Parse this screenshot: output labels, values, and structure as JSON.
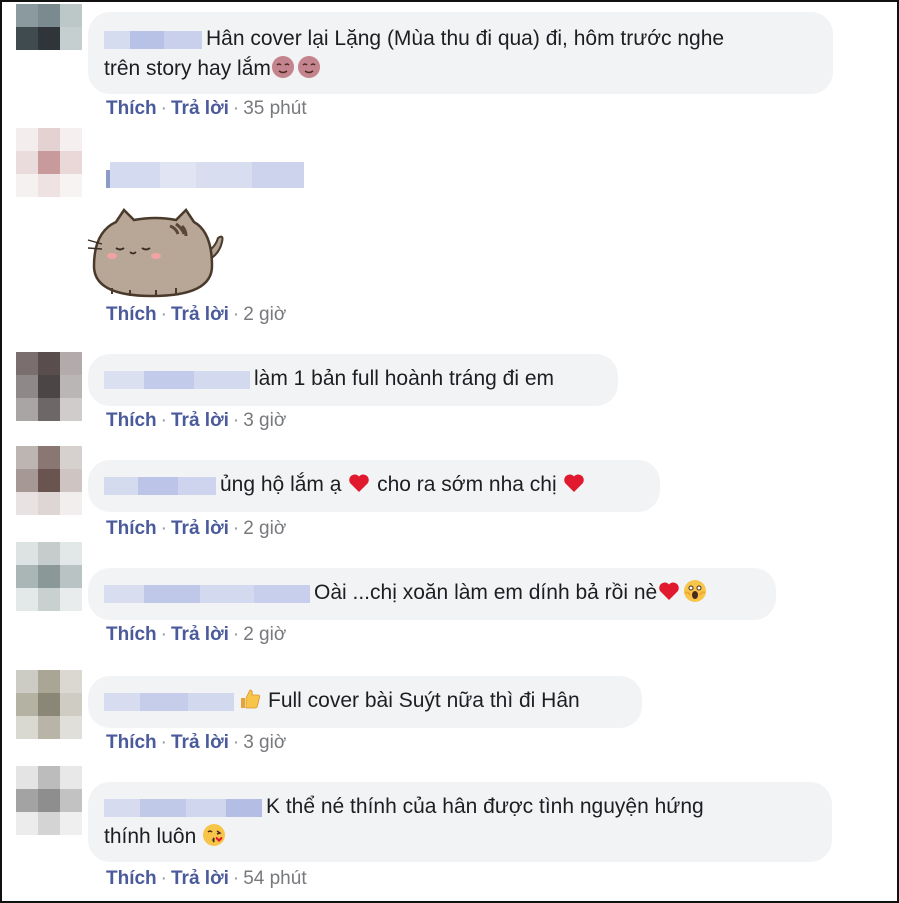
{
  "comments": [
    {
      "text": "Hân cover lại Lặng (Mùa thu đi qua) đi, hôm trước nghe",
      "text2": "trên story hay lắm",
      "like": "Thích",
      "reply": "Trả lời",
      "time": "35 phút"
    },
    {
      "sticker": "pusheen-cat-sticker",
      "like": "Thích",
      "reply": "Trả lời",
      "time": "2 giờ"
    },
    {
      "text": "làm 1 bản full hoành tráng đi em",
      "like": "Thích",
      "reply": "Trả lời",
      "time": "3 giờ"
    },
    {
      "text_a": "ủng hộ lắm ạ",
      "text_b": "cho ra sớm nha chị",
      "like": "Thích",
      "reply": "Trả lời",
      "time": "2 giờ"
    },
    {
      "text": "Oài ...chị xoăn làm em dính bả rồi nè",
      "like": "Thích",
      "reply": "Trả lời",
      "time": "2 giờ"
    },
    {
      "text": "Full cover bài Suýt nữa thì đi Hân",
      "like": "Thích",
      "reply": "Trả lời",
      "time": "3 giờ"
    },
    {
      "text": "K thể né thính của hân được tình nguyện hứng",
      "text2": "thính luôn",
      "like": "Thích",
      "reply": "Trả lời",
      "time": "54 phút"
    }
  ],
  "separator": "·",
  "colors": {
    "link": "#4a5a9b",
    "bubble": "#f2f3f5",
    "heart": "#e0192f"
  }
}
